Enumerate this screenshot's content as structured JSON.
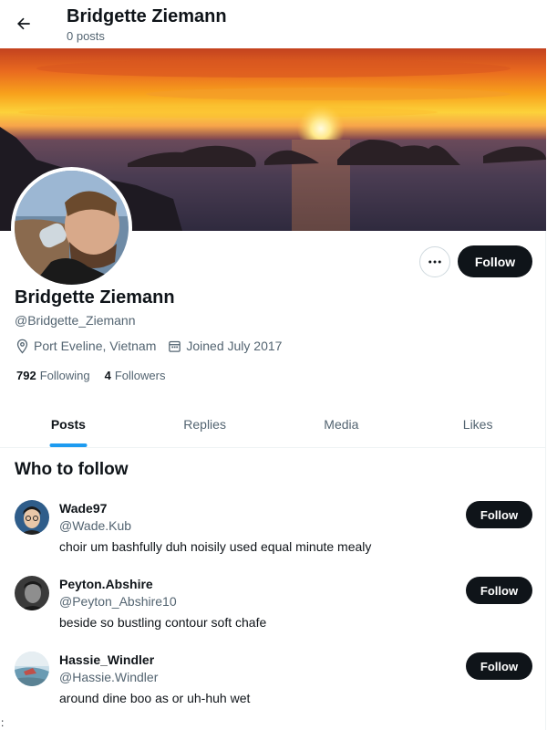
{
  "header": {
    "title": "Bridgette Ziemann",
    "post_count": "0 posts"
  },
  "profile": {
    "name": "Bridgette Ziemann",
    "handle": "@Bridgette_Ziemann",
    "location": "Port Eveline, Vietnam",
    "joined": "Joined July 2017",
    "following_count": "792",
    "following_label": "Following",
    "followers_count": "4",
    "followers_label": "Followers",
    "follow_label": "Follow",
    "more_icon": "ellipsis-icon"
  },
  "tabs": [
    {
      "label": "Posts",
      "active": true
    },
    {
      "label": "Replies",
      "active": false
    },
    {
      "label": "Media",
      "active": false
    },
    {
      "label": "Likes",
      "active": false
    }
  ],
  "who_to_follow": {
    "title": "Who to follow",
    "people": [
      {
        "name": "Wade97",
        "handle": "@Wade.Kub",
        "bio": "choir um bashfully duh noisily used equal minute mealy",
        "button": "Follow"
      },
      {
        "name": "Peyton.Abshire",
        "handle": "@Peyton_Abshire10",
        "bio": "beside so bustling contour soft chafe",
        "button": "Follow"
      },
      {
        "name": "Hassie_Windler",
        "handle": "@Hassie.Windler",
        "bio": "around dine boo as or uh-huh wet",
        "button": "Follow"
      }
    ]
  },
  "footer": {
    "corner_text": ":"
  },
  "colors": {
    "accent": "#1d9bf0",
    "button_dark": "#0f1419",
    "secondary_text": "#536471"
  }
}
